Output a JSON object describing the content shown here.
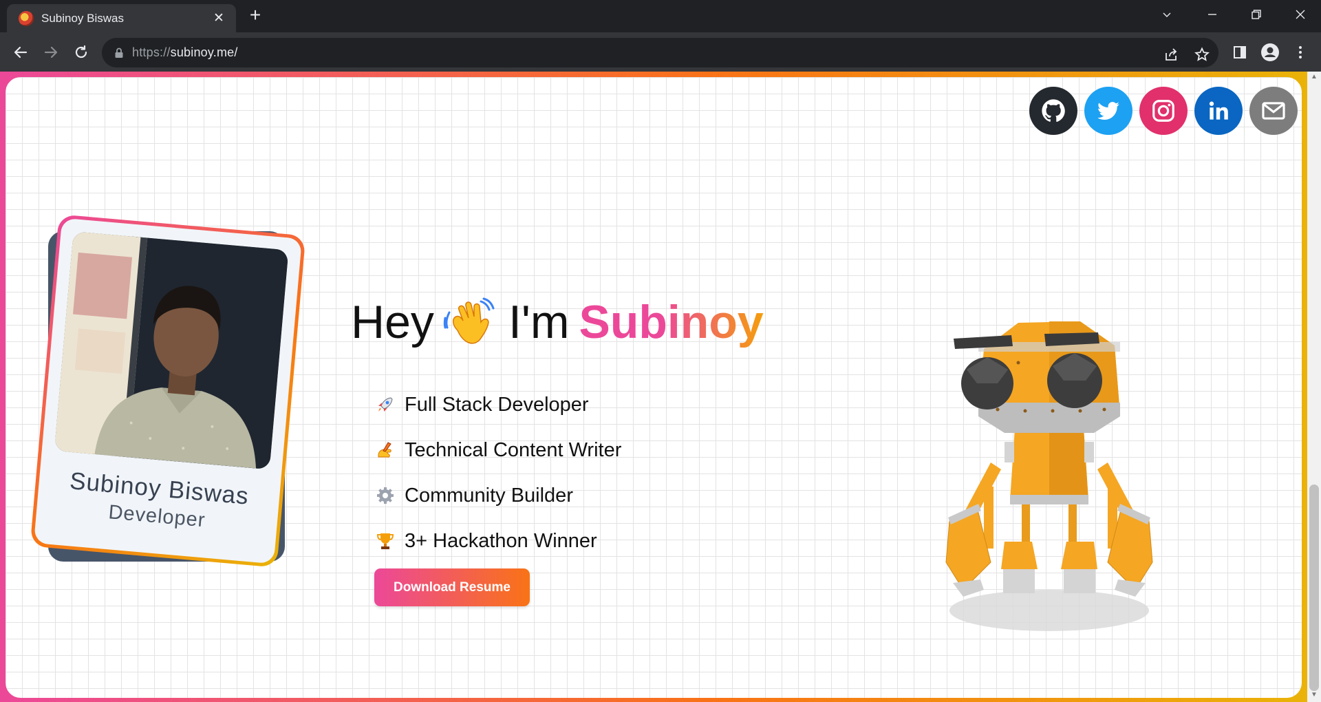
{
  "browser": {
    "tab_title": "Subinoy Biswas",
    "tab_close": "✕",
    "new_tab": "+",
    "url_scheme": "https://",
    "url_host": "subinoy.me/"
  },
  "page": {
    "card": {
      "name": "Subinoy Biswas",
      "role": "Developer"
    },
    "hero": {
      "greeting": "Hey",
      "intro": "I'm",
      "name": "Subinoy"
    },
    "roles": [
      {
        "icon": "rocket-icon",
        "label": "Full Stack Developer"
      },
      {
        "icon": "writing-hand-icon",
        "label": "Technical Content Writer"
      },
      {
        "icon": "gear-icon",
        "label": "Community Builder"
      },
      {
        "icon": "trophy-icon",
        "label": "3+ Hackathon Winner"
      }
    ],
    "resume_button": "Download Resume",
    "socials": [
      {
        "name": "github-icon",
        "color": "#24292f"
      },
      {
        "name": "twitter-icon",
        "color": "#1da1f2"
      },
      {
        "name": "instagram-icon",
        "color": "#e1306c"
      },
      {
        "name": "linkedin-icon",
        "color": "#0a66c2"
      },
      {
        "name": "mail-icon",
        "color": "#7d7d7d"
      }
    ],
    "accent_gradient": [
      "#ec4899",
      "#f97316",
      "#eab308"
    ]
  }
}
